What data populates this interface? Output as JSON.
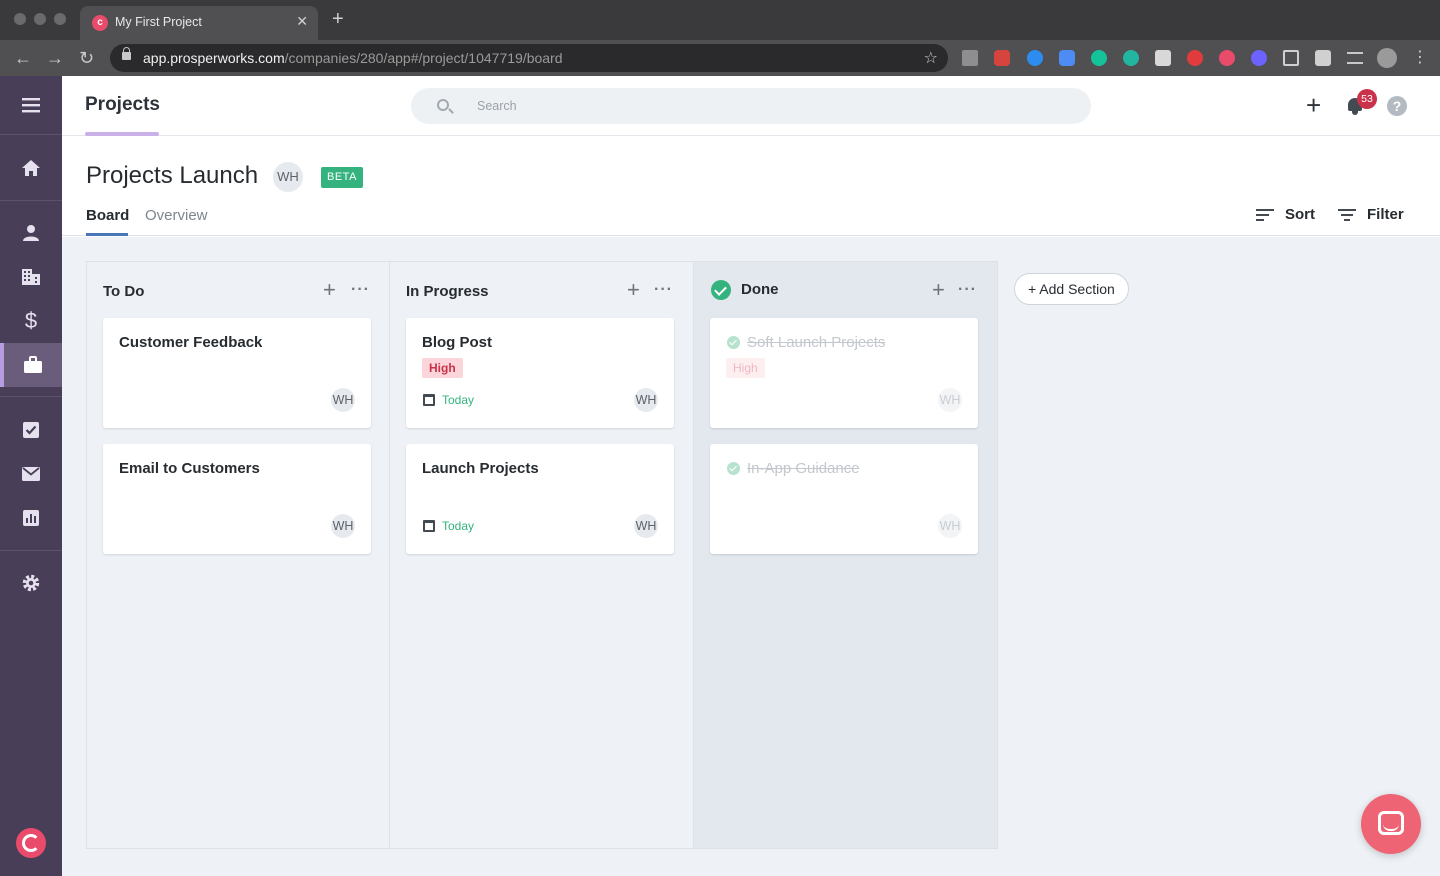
{
  "browser": {
    "tab_title": "My First Project",
    "tab_close": "✕",
    "new_tab": "+",
    "url_host": "app.prosperworks.com",
    "url_path": "/companies/280/app#/project/1047719/board",
    "back": "←",
    "forward": "→",
    "reload": "↻",
    "star": "☆"
  },
  "header": {
    "title": "Projects",
    "search_placeholder": "Search",
    "add": "+",
    "notification_count": "53",
    "help": "?"
  },
  "project": {
    "title": "Projects Launch",
    "owner_initials": "WH",
    "badge": "BETA",
    "tabs": {
      "board": "Board",
      "overview": "Overview"
    },
    "sort_label": "Sort",
    "filter_label": "Filter"
  },
  "board": {
    "add_section": "+ Add Section",
    "column_add": "+",
    "column_more": "···",
    "columns": [
      {
        "title": "To Do",
        "cards": [
          {
            "title": "Customer Feedback",
            "assignee": "WH"
          },
          {
            "title": "Email to Customers",
            "assignee": "WH"
          }
        ]
      },
      {
        "title": "In Progress",
        "cards": [
          {
            "title": "Blog Post",
            "priority": "High",
            "due": "Today",
            "assignee": "WH"
          },
          {
            "title": "Launch Projects",
            "due": "Today",
            "assignee": "WH"
          }
        ]
      },
      {
        "title": "Done",
        "cards": [
          {
            "title": "Soft Launch Projects",
            "priority": "High",
            "assignee": "WH"
          },
          {
            "title": "In-App Guidance",
            "assignee": "WH"
          }
        ]
      }
    ]
  },
  "colors": {
    "rail": "#493e57",
    "accent_green": "#35b37e",
    "priority_red": "#c8324b",
    "badge_red": "#c9324a",
    "brand_pink": "#ea4b6b"
  }
}
